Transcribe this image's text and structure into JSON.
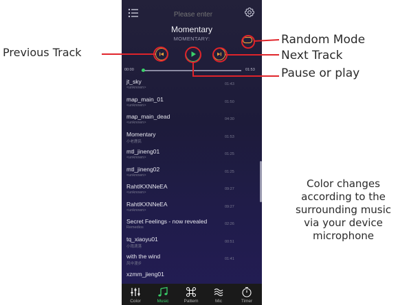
{
  "search": {
    "placeholder": "Please enter"
  },
  "now_playing": {
    "title": "Momentary",
    "subtitle": "MOMENTARY:"
  },
  "progress": {
    "elapsed": "00:00",
    "duration": "01:53",
    "fraction": 0.02
  },
  "tracks": [
    {
      "name": "jt_sky",
      "artist": "<unknown>",
      "duration": "01:43"
    },
    {
      "name": "map_main_01",
      "artist": "<unknown>",
      "duration": "01:50"
    },
    {
      "name": "map_main_dead",
      "artist": "<unknown>",
      "duration": "04:30"
    },
    {
      "name": "Momentary",
      "artist": "小老鹿民",
      "duration": "01:53"
    },
    {
      "name": "mtl_jineng01",
      "artist": "<unknown>",
      "duration": "01:25"
    },
    {
      "name": "mtl_jineng02",
      "artist": "<unknown>",
      "duration": "01:25"
    },
    {
      "name": "RahtlKXNNeEA",
      "artist": "<unknown>",
      "duration": "09:27"
    },
    {
      "name": "RahtlKXNNeEA",
      "artist": "<unknown>",
      "duration": "09:27"
    },
    {
      "name": "Secret Feelings - now revealed",
      "artist": "Remedios",
      "duration": "02:26"
    },
    {
      "name": "tq_xiaoyu01",
      "artist": "小雨滴落",
      "duration": "00:51"
    },
    {
      "name": "with the wind",
      "artist": "风中漫步",
      "duration": "01:41"
    },
    {
      "name": "xzmm_jieng01",
      "artist": "",
      "duration": ""
    }
  ],
  "nav": [
    {
      "label": "Color",
      "icon": "sliders-icon"
    },
    {
      "label": "Music",
      "icon": "music-note-icon"
    },
    {
      "label": "Pattern",
      "icon": "command-icon"
    },
    {
      "label": "Mic",
      "icon": "soundwave-icon"
    },
    {
      "label": "Timer",
      "icon": "timer-icon"
    }
  ],
  "annotations": {
    "random_mode": "Random Mode",
    "next_track": "Next Track",
    "pause_play": "Pause or play",
    "previous_track": "Previous Track",
    "color_change": "Color changes according to the surrounding music via your device microphone"
  },
  "colors": {
    "accent": "#3ad16a",
    "control": "#e8a03a",
    "annotation_line": "#e0242a"
  }
}
